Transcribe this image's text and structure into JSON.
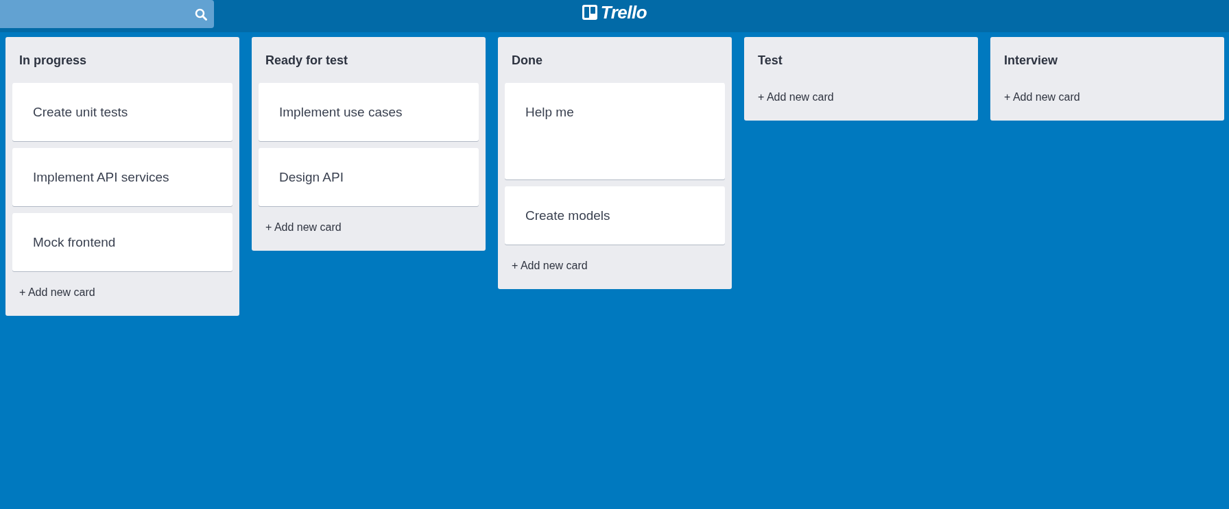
{
  "header": {
    "logo": {
      "text": "Trello"
    }
  },
  "lists": [
    {
      "title": "In progress",
      "cards": [
        {
          "text": "Create unit tests",
          "kind": "normal"
        },
        {
          "text": "Implement API services",
          "kind": "normal"
        },
        {
          "text": "Mock frontend",
          "kind": "normal"
        }
      ],
      "add_label": "+ Add new card"
    },
    {
      "title": "Ready for test",
      "cards": [
        {
          "text": "Implement use cases",
          "kind": "normal"
        },
        {
          "text": "Design API",
          "kind": "normal"
        }
      ],
      "add_label": "+ Add new card"
    },
    {
      "title": "Done",
      "cards": [
        {
          "text": "Help me",
          "kind": "tall"
        },
        {
          "text": "Create models",
          "kind": "normal"
        }
      ],
      "add_label": "+ Add new card"
    },
    {
      "title": "Test",
      "add_label": "+ Add new card"
    },
    {
      "title": "Interview",
      "add_label": "+ Add new card"
    }
  ]
}
